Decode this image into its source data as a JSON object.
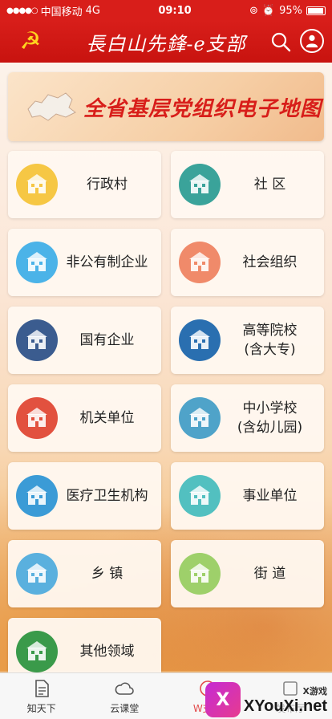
{
  "status_bar": {
    "signal": "●●●●○",
    "carrier": "中国移动",
    "network": "4G",
    "time": "09:10",
    "battery": "95%"
  },
  "header": {
    "title": "長白山先鋒-e支部"
  },
  "banner": {
    "text": "全省基层党组织电子地图"
  },
  "categories": [
    {
      "label": "行政村",
      "icon": "village-icon",
      "color": "#f6c744"
    },
    {
      "label": "社 区",
      "icon": "community-icon",
      "color": "#3aa39a"
    },
    {
      "label": "非公有制企业",
      "icon": "private-enterprise-icon",
      "color": "#4bb3e8"
    },
    {
      "label": "社会组织",
      "icon": "social-org-icon",
      "color": "#f08a6a"
    },
    {
      "label": "国有企业",
      "icon": "state-enterprise-icon",
      "color": "#3b5c8f"
    },
    {
      "label": "高等院校\n(含大专)",
      "icon": "university-icon",
      "color": "#2a6fb0"
    },
    {
      "label": "机关单位",
      "icon": "government-icon",
      "color": "#e2513f"
    },
    {
      "label": "中小学校\n(含幼儿园)",
      "icon": "school-icon",
      "color": "#4fa3c9"
    },
    {
      "label": "医疗卫生机构",
      "icon": "hospital-icon",
      "color": "#3b9bd6"
    },
    {
      "label": "事业单位",
      "icon": "public-institution-icon",
      "color": "#52c0c0"
    },
    {
      "label": "乡 镇",
      "icon": "township-icon",
      "color": "#5ab0de"
    },
    {
      "label": "街 道",
      "icon": "street-icon",
      "color": "#9ed06a"
    },
    {
      "label": "其他领域",
      "icon": "other-fields-icon",
      "color": "#3a9a4a"
    }
  ],
  "tabbar": {
    "tabs": [
      {
        "label": "知天下",
        "icon": "document-icon"
      },
      {
        "label": "云课堂",
        "icon": "cloud-icon"
      },
      {
        "label": "W支部",
        "icon": "branch-icon"
      },
      {
        "label": "发布厅",
        "icon": "publish-icon"
      }
    ]
  },
  "watermark": {
    "logo_letter": "X",
    "small": "X游戏",
    "big": "XYouXi.net"
  },
  "colors": {
    "primary_red": "#d81e1a",
    "gold": "#ffd21f"
  }
}
